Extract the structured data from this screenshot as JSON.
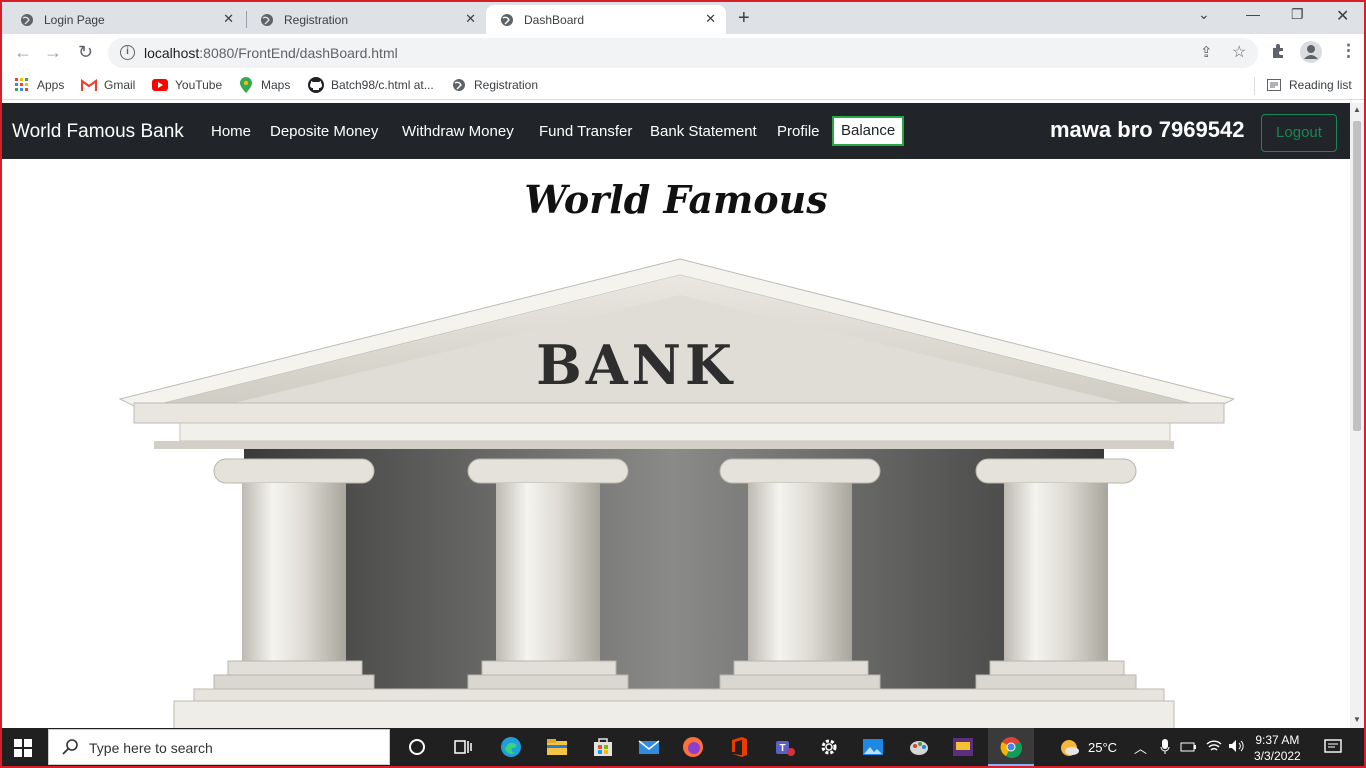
{
  "browser": {
    "tabs": [
      {
        "title": "Login Page",
        "active": false
      },
      {
        "title": "Registration",
        "active": false
      },
      {
        "title": "DashBoard",
        "active": true
      }
    ],
    "url_host": "localhost",
    "url_rest": ":8080/FrontEnd/dashBoard.html",
    "bookmarks": [
      "Apps",
      "Gmail",
      "YouTube",
      "Maps",
      "Batch98/c.html at...",
      "Registration"
    ],
    "reading_list": "Reading list"
  },
  "navbar": {
    "brand": "World Famous Bank",
    "links": [
      "Home",
      "Deposite Money",
      "Withdraw Money",
      "Fund Transfer",
      "Bank Statement",
      "Profile"
    ],
    "balance_label": "Balance",
    "user": "mawa bro 7969542",
    "logout_label": "Logout"
  },
  "main": {
    "heading": "World Famous",
    "image_sign": "BANK"
  },
  "taskbar": {
    "search_placeholder": "Type here to search",
    "temperature": "25°C",
    "time": "9:37 AM",
    "date": "3/3/2022"
  },
  "colors": {
    "navbar_bg": "#212529",
    "accent_green": "#198754",
    "window_border": "#d81e2a"
  }
}
